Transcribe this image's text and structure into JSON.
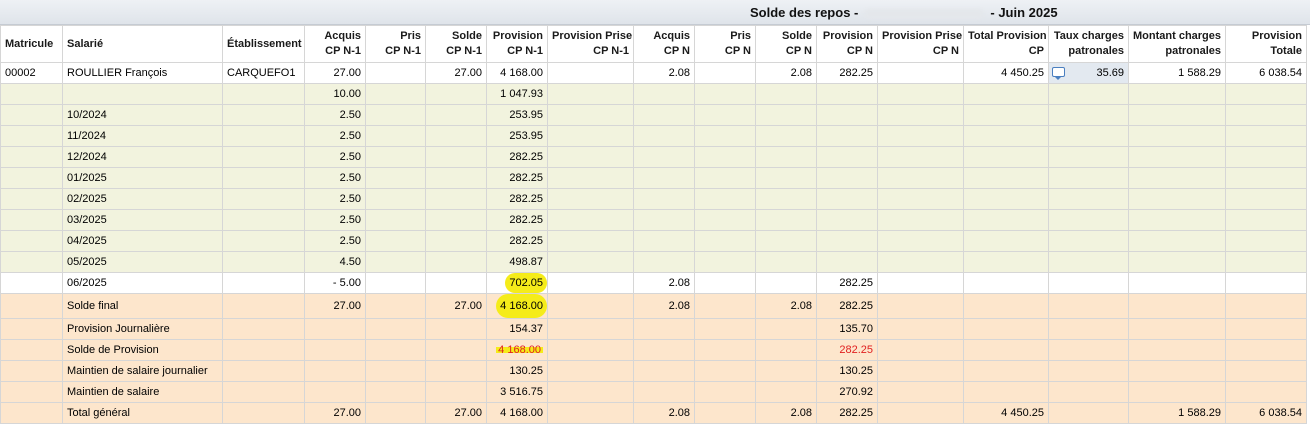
{
  "title": {
    "text": "Solde des repos -",
    "period": "- Juin 2025"
  },
  "columns": [
    {
      "key": "matricule",
      "label": "Matricule",
      "label2": ""
    },
    {
      "key": "salarie",
      "label": "Salarié",
      "label2": ""
    },
    {
      "key": "etab",
      "label": "Établissement",
      "label2": ""
    },
    {
      "key": "acquis_n1",
      "label": "Acquis",
      "label2": "CP N-1"
    },
    {
      "key": "pris_n1",
      "label": "Pris",
      "label2": "CP N-1"
    },
    {
      "key": "solde_n1",
      "label": "Solde",
      "label2": "CP N-1"
    },
    {
      "key": "prov_n1",
      "label": "Provision",
      "label2": "CP N-1"
    },
    {
      "key": "provprise_n1",
      "label": "Provision Prise",
      "label2": "CP N-1"
    },
    {
      "key": "acquis_n",
      "label": "Acquis",
      "label2": "CP N"
    },
    {
      "key": "pris_n",
      "label": "Pris",
      "label2": "CP N"
    },
    {
      "key": "solde_n",
      "label": "Solde",
      "label2": "CP N"
    },
    {
      "key": "prov_n",
      "label": "Provision",
      "label2": "CP N"
    },
    {
      "key": "provprise_n",
      "label": "Provision Prise",
      "label2": "CP N"
    },
    {
      "key": "total_prov",
      "label": "Total Provision",
      "label2": "CP"
    },
    {
      "key": "taux",
      "label": "Taux charges",
      "label2": "patronales"
    },
    {
      "key": "montant",
      "label": "Montant charges",
      "label2": "patronales"
    },
    {
      "key": "prov_totale",
      "label": "Provision",
      "label2": "Totale"
    }
  ],
  "employee": {
    "matricule": "00002",
    "salarie": "ROULLIER François",
    "etab": "CARQUEFO1",
    "acquis_n1": "27.00",
    "pris_n1": "",
    "solde_n1": "27.00",
    "prov_n1": "4 168.00",
    "provprise_n1": "",
    "acquis_n": "2.08",
    "pris_n": "",
    "solde_n": "2.08",
    "prov_n": "282.25",
    "provprise_n": "",
    "total_prov": "4 450.25",
    "taux": "35.69",
    "montant": "1 588.29",
    "prov_totale": "6 038.54"
  },
  "history": [
    {
      "label": "",
      "acquis_n1": "10.00",
      "prov_n1": "1 047.93"
    },
    {
      "label": "10/2024",
      "acquis_n1": "2.50",
      "prov_n1": "253.95"
    },
    {
      "label": "11/2024",
      "acquis_n1": "2.50",
      "prov_n1": "253.95"
    },
    {
      "label": "12/2024",
      "acquis_n1": "2.50",
      "prov_n1": "282.25"
    },
    {
      "label": "01/2025",
      "acquis_n1": "2.50",
      "prov_n1": "282.25"
    },
    {
      "label": "02/2025",
      "acquis_n1": "2.50",
      "prov_n1": "282.25"
    },
    {
      "label": "03/2025",
      "acquis_n1": "2.50",
      "prov_n1": "282.25"
    },
    {
      "label": "04/2025",
      "acquis_n1": "2.50",
      "prov_n1": "282.25"
    },
    {
      "label": "05/2025",
      "acquis_n1": "4.50",
      "prov_n1": "498.87"
    }
  ],
  "current": {
    "label": "06/2025",
    "acquis_n1": "- 5.00",
    "prov_n1": "702.05",
    "acquis_n": "2.08",
    "prov_n": "282.25"
  },
  "summary": {
    "solde_final": {
      "label": "Solde final",
      "acquis_n1": "27.00",
      "solde_n1": "27.00",
      "prov_n1": "4 168.00",
      "acquis_n": "2.08",
      "solde_n": "2.08",
      "prov_n": "282.25"
    },
    "prov_journaliere": {
      "label": "Provision Journalière",
      "prov_n1": "154.37",
      "prov_n": "135.70"
    },
    "solde_provision": {
      "label": "Solde de Provision",
      "prov_n1": "4 168.00",
      "prov_n": "282.25"
    },
    "maintien_journalier": {
      "label": "Maintien de salaire journalier",
      "prov_n1": "130.25",
      "prov_n": "130.25"
    },
    "maintien": {
      "label": "Maintien de salaire",
      "prov_n1": "3 516.75",
      "prov_n": "270.92"
    },
    "total_general": {
      "label": "Total général",
      "acquis_n1": "27.00",
      "solde_n1": "27.00",
      "prov_n1": "4 168.00",
      "acquis_n": "2.08",
      "solde_n": "2.08",
      "prov_n": "282.25",
      "total_prov": "4 450.25",
      "montant": "1 588.29",
      "prov_totale": "6 038.54"
    }
  },
  "colors": {
    "history_bg": "#f2f3de",
    "summary_bg": "#fde6cc",
    "highlight": "#f5ec1a",
    "negative_red": "#e02020"
  },
  "icons": {
    "taux_comment": "comment-icon"
  }
}
